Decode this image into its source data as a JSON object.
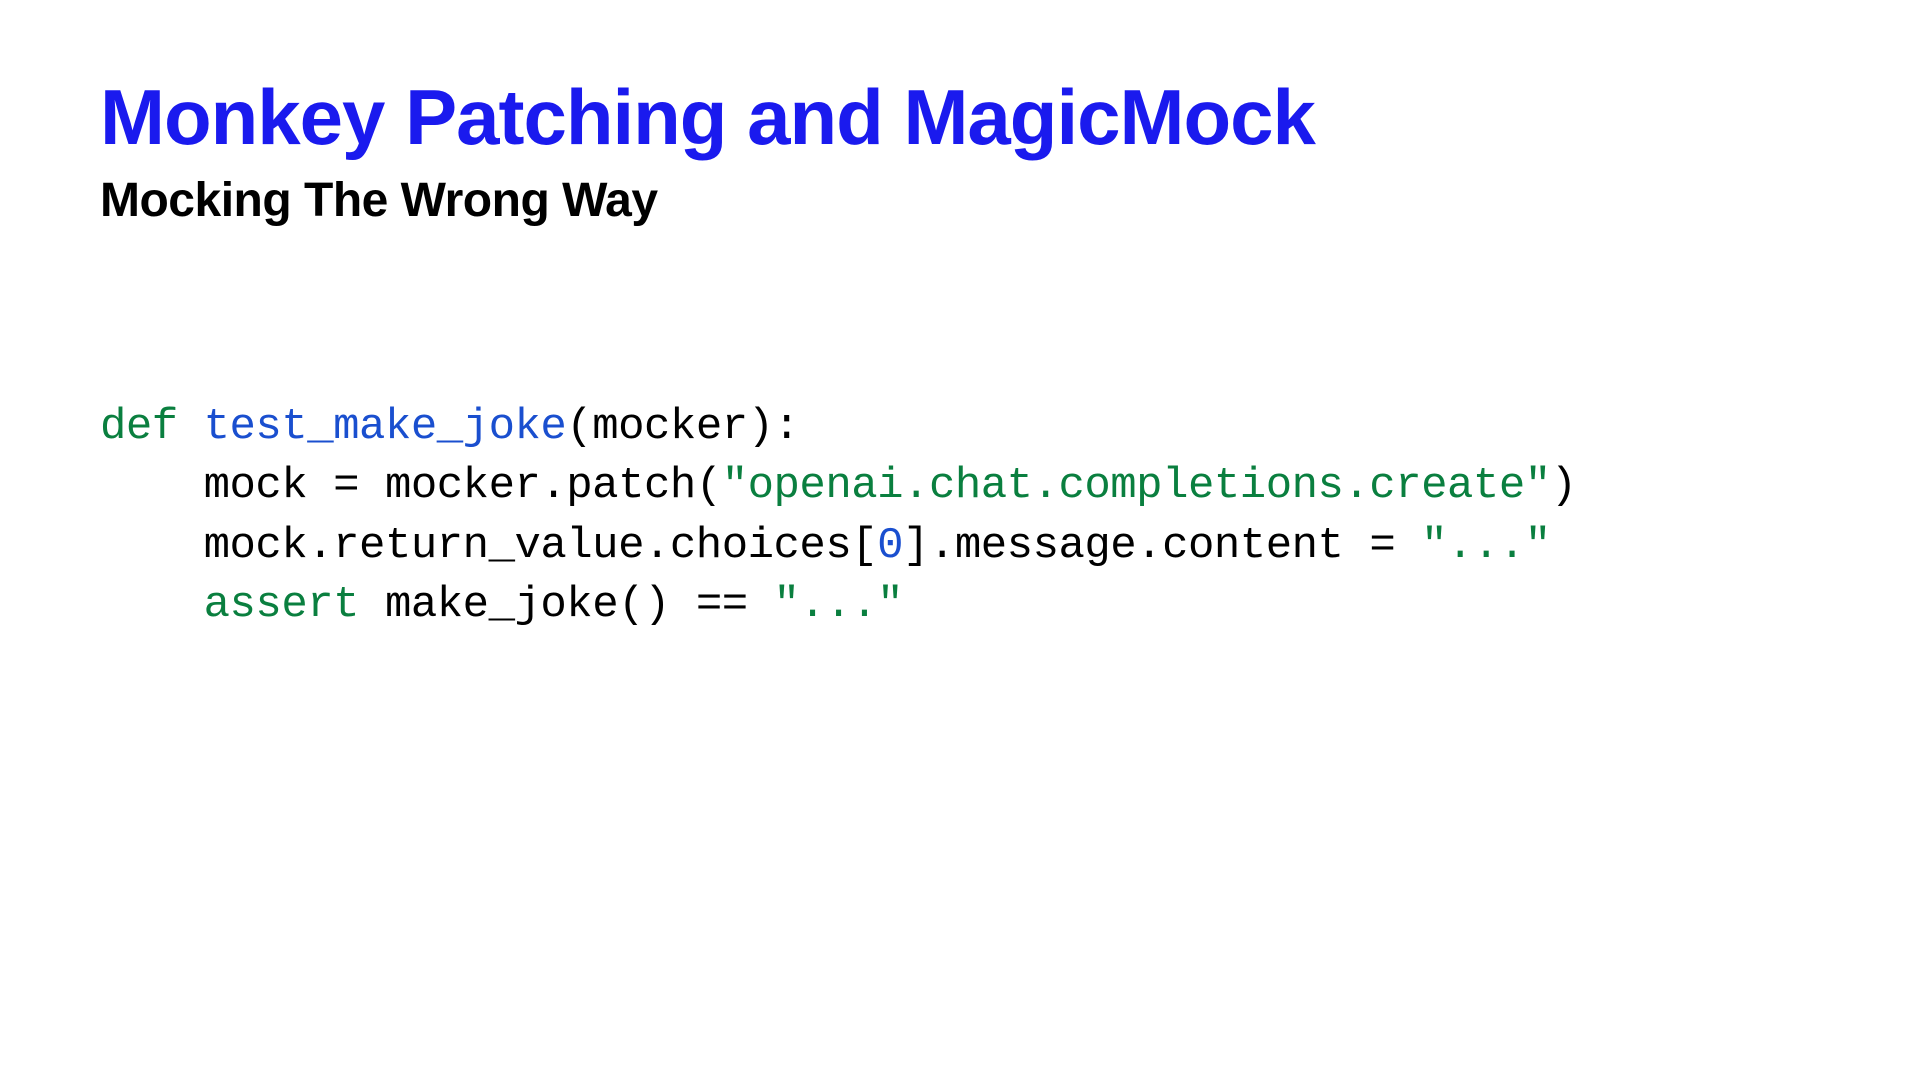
{
  "slide": {
    "title": "Monkey Patching and MagicMock",
    "subtitle": "Mocking The Wrong Way"
  },
  "code": {
    "kw_def": "def",
    "fn_name": "test_make_joke",
    "param_open": "(mocker):",
    "line2_a": "    mock = mocker.patch(",
    "line2_str": "\"openai.chat.completions.create\"",
    "line2_b": ")",
    "line3_a": "    mock.return_value.choices[",
    "line3_num": "0",
    "line3_b": "].message.content = ",
    "line3_str": "\"...\"",
    "line4_indent": "    ",
    "kw_assert": "assert",
    "line4_a": " make_joke() == ",
    "line4_str": "\"...\""
  }
}
